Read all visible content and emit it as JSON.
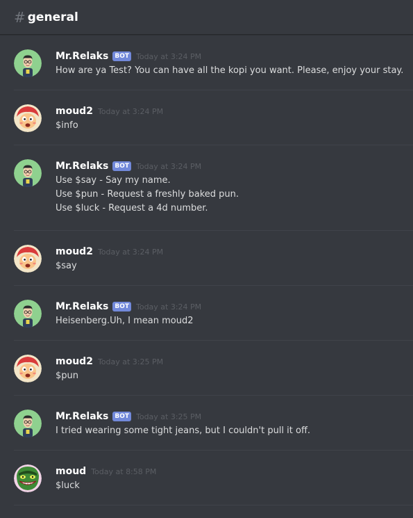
{
  "header": {
    "hash": "#",
    "channel": "general"
  },
  "bot_tag": "BOT",
  "colors": {
    "background": "#36393f",
    "bot_tag": "#7289da",
    "text": "#dcddde",
    "timestamp": "#5b5e64"
  },
  "messages": [
    {
      "author": "Mr.Relaks",
      "bot": true,
      "time": "Today at 3:24 PM",
      "avatar": "glasses-man-avatar",
      "lines": [
        "How are ya Test? You can have all the kopi you want. Please, enjoy your stay."
      ]
    },
    {
      "author": "moud2",
      "bot": false,
      "time": "Today at 3:24 PM",
      "avatar": "red-hair-cartoon-avatar",
      "lines": [
        "$info"
      ]
    },
    {
      "author": "Mr.Relaks",
      "bot": true,
      "time": "Today at 3:24 PM",
      "avatar": "glasses-man-avatar",
      "lines": [
        "Use $say - Say my name.",
        "Use $pun - Request a freshly baked pun.",
        "Use $luck - Request a 4d number."
      ]
    },
    {
      "author": "moud2",
      "bot": false,
      "time": "Today at 3:24 PM",
      "avatar": "red-hair-cartoon-avatar",
      "lines": [
        "$say"
      ]
    },
    {
      "author": "Mr.Relaks",
      "bot": true,
      "time": "Today at 3:24 PM",
      "avatar": "glasses-man-avatar",
      "lines": [
        "Heisenberg.Uh, I mean moud2"
      ]
    },
    {
      "author": "moud2",
      "bot": false,
      "time": "Today at 3:25 PM",
      "avatar": "red-hair-cartoon-avatar",
      "lines": [
        "$pun"
      ]
    },
    {
      "author": "Mr.Relaks",
      "bot": true,
      "time": "Today at 3:25 PM",
      "avatar": "glasses-man-avatar",
      "lines": [
        "I tried wearing some tight jeans, but I couldn't pull it off."
      ]
    },
    {
      "author": "moud",
      "bot": false,
      "time": "Today at 8:58 PM",
      "avatar": "green-grin-mask-avatar",
      "lines": [
        "$luck"
      ]
    }
  ]
}
